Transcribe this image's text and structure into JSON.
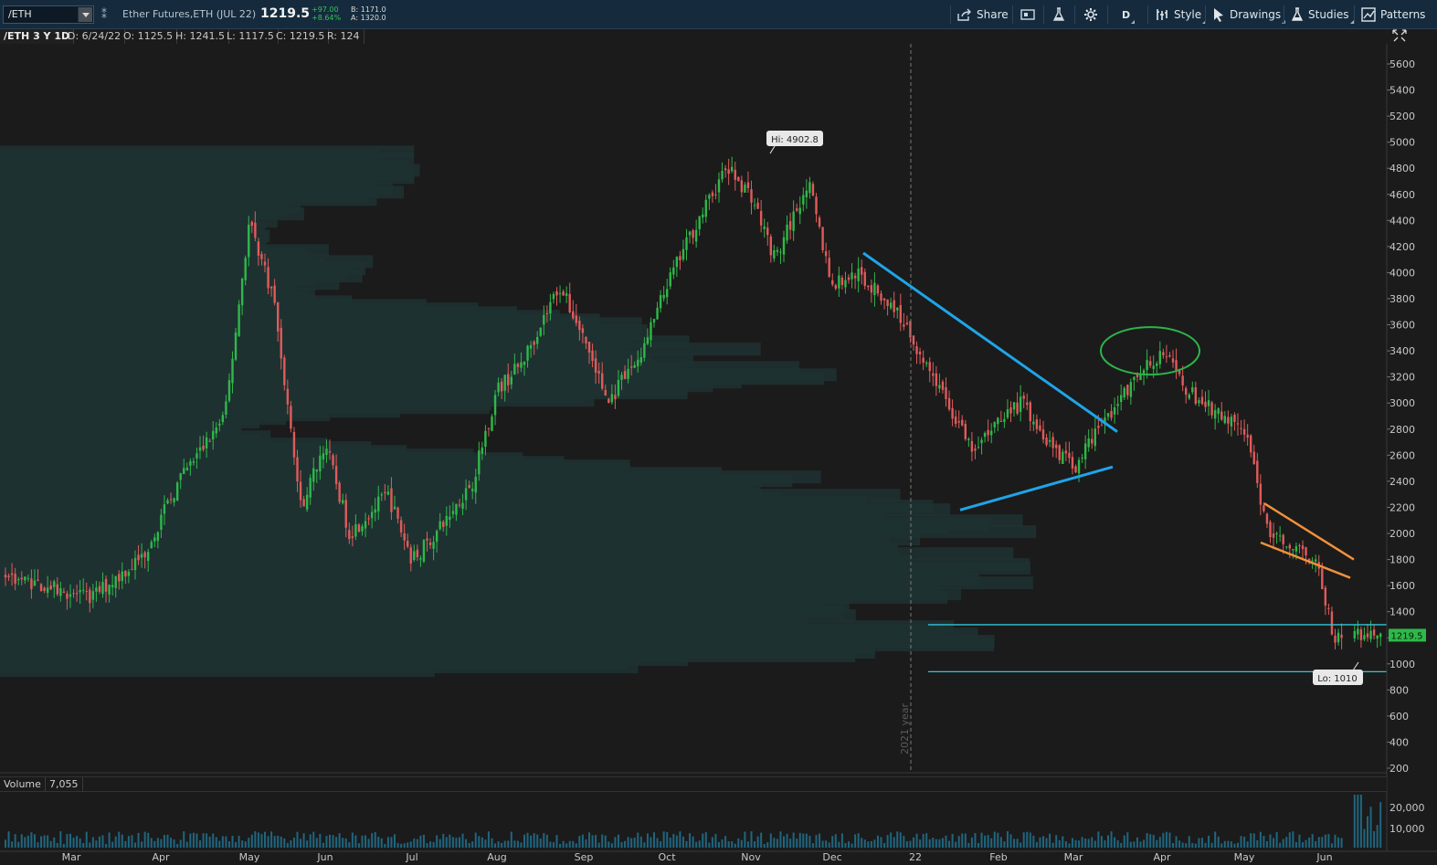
{
  "toolbar": {
    "symbol": "/ETH",
    "description": "Ether Futures,ETH (JUL 22)",
    "last": "1219.5",
    "change": "+97.00",
    "change_pct": "+8.64%",
    "bid": "B: 1171.0",
    "ask": "A: 1320.0",
    "share_label": "Share",
    "aggregation": "D",
    "style_label": "Style",
    "drawings_label": "Drawings",
    "studies_label": "Studies",
    "patterns_label": "Patterns"
  },
  "infobar": {
    "title": "/ETH 3 Y 1D",
    "date": "D: 6/24/22",
    "open": "O: 1125.5",
    "high": "H: 1241.5",
    "low": "L: 1117.5",
    "close": "C: 1219.5",
    "range": "R: 124"
  },
  "volume_bar": {
    "label": "Volume",
    "value": "7,055"
  },
  "chart_data": {
    "type": "candlestick",
    "price_axis": {
      "ticks": [
        5600,
        5400,
        5200,
        5000,
        4800,
        4600,
        4400,
        4200,
        4000,
        3800,
        3600,
        3400,
        3200,
        3000,
        2800,
        2600,
        2400,
        2200,
        2000,
        1800,
        1600,
        1400,
        1200,
        1000,
        800,
        600,
        400,
        200
      ],
      "range": [
        200,
        5700
      ]
    },
    "volume_axis": {
      "ticks": [
        "20,000",
        "10,000"
      ]
    },
    "x_ticks": [
      "Mar",
      "Apr",
      "May",
      "Jun",
      "Jul",
      "Aug",
      "Sep",
      "Oct",
      "Nov",
      "Dec",
      "22",
      "Feb",
      "Mar",
      "Apr",
      "May",
      "Jun"
    ],
    "year_marker": "2021 year",
    "hi_label": "Hi: 4902.8",
    "lo_label": "Lo: 1010",
    "last_price_tag": "1219.5",
    "horizontal_levels": [
      1300,
      940
    ],
    "trendlines": {
      "descending": {
        "from": [
          "Dec",
          4150
        ],
        "to": [
          "Mar",
          2780
        ]
      },
      "ascending": {
        "from": [
          "Feb",
          2180
        ],
        "to": [
          "Mar",
          2510
        ]
      },
      "flag_upper": {
        "from": [
          "May",
          2230
        ],
        "to": [
          "Jun",
          1800
        ]
      },
      "flag_lower": {
        "from": [
          "May",
          1930
        ],
        "to": [
          "Jun",
          1660
        ]
      }
    },
    "price_path": [
      [
        1680,
        "Mar"
      ],
      [
        1500,
        "Mar"
      ],
      [
        1820,
        "Apr"
      ],
      [
        2400,
        "Apr"
      ],
      [
        2900,
        "May"
      ],
      [
        4400,
        "May"
      ],
      [
        3800,
        "May"
      ],
      [
        2200,
        "Jun"
      ],
      [
        2700,
        "Jun"
      ],
      [
        2000,
        "Jun"
      ],
      [
        2300,
        "Jul"
      ],
      [
        1800,
        "Jul"
      ],
      [
        2000,
        "Jul"
      ],
      [
        2400,
        "Aug"
      ],
      [
        3100,
        "Aug"
      ],
      [
        3300,
        "Aug"
      ],
      [
        3900,
        "Sep"
      ],
      [
        3500,
        "Sep"
      ],
      [
        3000,
        "Sep"
      ],
      [
        3400,
        "Oct"
      ],
      [
        3900,
        "Oct"
      ],
      [
        4300,
        "Oct"
      ],
      [
        4800,
        "Nov"
      ],
      [
        4600,
        "Nov"
      ],
      [
        4100,
        "Nov"
      ],
      [
        4700,
        "Dec"
      ],
      [
        3900,
        "Dec"
      ],
      [
        4000,
        "Dec"
      ],
      [
        3700,
        "22"
      ],
      [
        3200,
        "22"
      ],
      [
        2600,
        "Feb"
      ],
      [
        2900,
        "Feb"
      ],
      [
        3000,
        "Feb"
      ],
      [
        2700,
        "Mar"
      ],
      [
        2500,
        "Mar"
      ],
      [
        2800,
        "Mar"
      ],
      [
        3200,
        "Apr"
      ],
      [
        3400,
        "Apr"
      ],
      [
        3100,
        "Apr"
      ],
      [
        2900,
        "May"
      ],
      [
        2800,
        "May"
      ],
      [
        2000,
        "May"
      ],
      [
        1900,
        "Jun"
      ],
      [
        1800,
        "Jun"
      ],
      [
        1200,
        "Jun"
      ],
      [
        1220,
        "Jun"
      ]
    ]
  }
}
